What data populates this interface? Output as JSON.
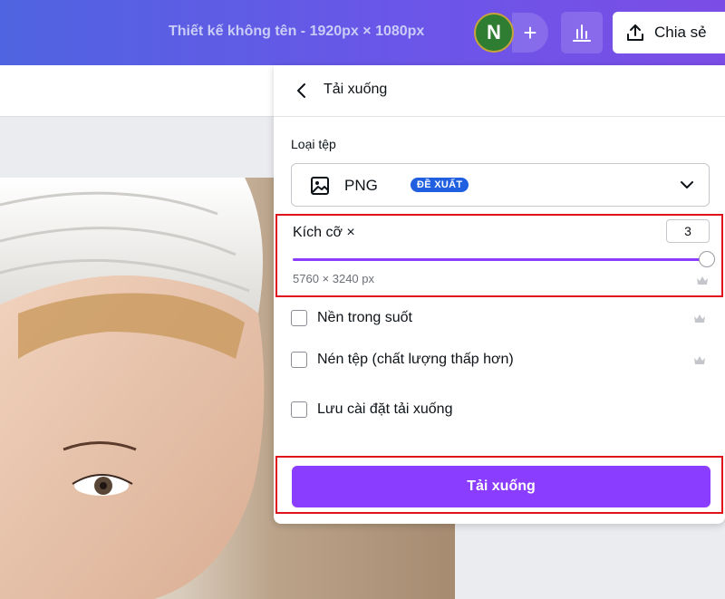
{
  "header": {
    "doc_title": "Thiết kế không tên - 1920px × 1080px",
    "avatar_initial": "N",
    "add_label": "+",
    "share_label": "Chia sẻ"
  },
  "panel": {
    "title": "Tải xuống",
    "file_type_label": "Loại tệp",
    "file_type_value": "PNG",
    "file_type_badge": "ĐỀ XUẤT",
    "size_label": "Kích cỡ ×",
    "size_value": "3",
    "size_slider_fraction": 1.0,
    "size_dimensions": "5760 × 3240 px",
    "options": [
      {
        "label": "Nền trong suốt",
        "checked": false,
        "premium": true
      },
      {
        "label": "Nén tệp (chất lượng thấp hơn)",
        "checked": false,
        "premium": true
      },
      {
        "label": "Lưu cài đặt tải xuống",
        "checked": false,
        "premium": false
      }
    ],
    "download_button": "Tải xuống"
  },
  "colors": {
    "accent": "#8b3dff",
    "badge": "#1f5fe0",
    "highlight_border": "#e0131c"
  }
}
